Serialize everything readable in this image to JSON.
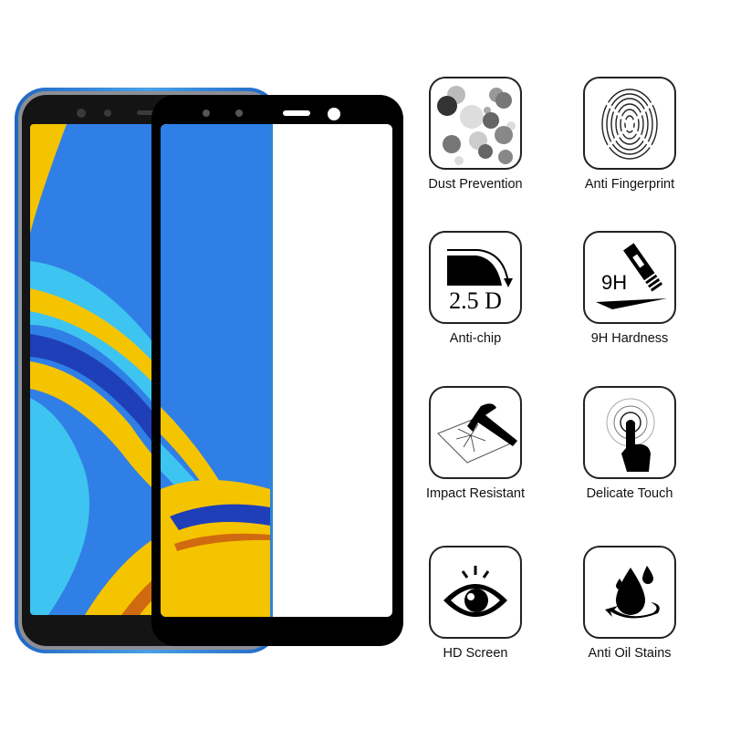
{
  "product": {
    "phone_color_accent": "#2a86d4",
    "protector_color": "#000000",
    "wallpaper_colors": [
      "#2f7fe6",
      "#f5c400",
      "#3ec4f0",
      "#1f3fb8",
      "#d06a10"
    ]
  },
  "features": [
    {
      "label": "Dust Prevention",
      "icon": "dust-circles-icon"
    },
    {
      "label": "Anti Fingerprint",
      "icon": "fingerprint-icon"
    },
    {
      "label": "Anti-chip",
      "icon": "curved-edge-icon",
      "icon_text": "2.5 D"
    },
    {
      "label": "9H Hardness",
      "icon": "scraper-blade-icon",
      "icon_text": "9H"
    },
    {
      "label": "Impact Resistant",
      "icon": "hammer-glass-icon"
    },
    {
      "label": "Delicate Touch",
      "icon": "touch-finger-icon"
    },
    {
      "label": "HD Screen",
      "icon": "eye-icon"
    },
    {
      "label": "Anti Oil Stains",
      "icon": "oil-drop-icon"
    }
  ]
}
